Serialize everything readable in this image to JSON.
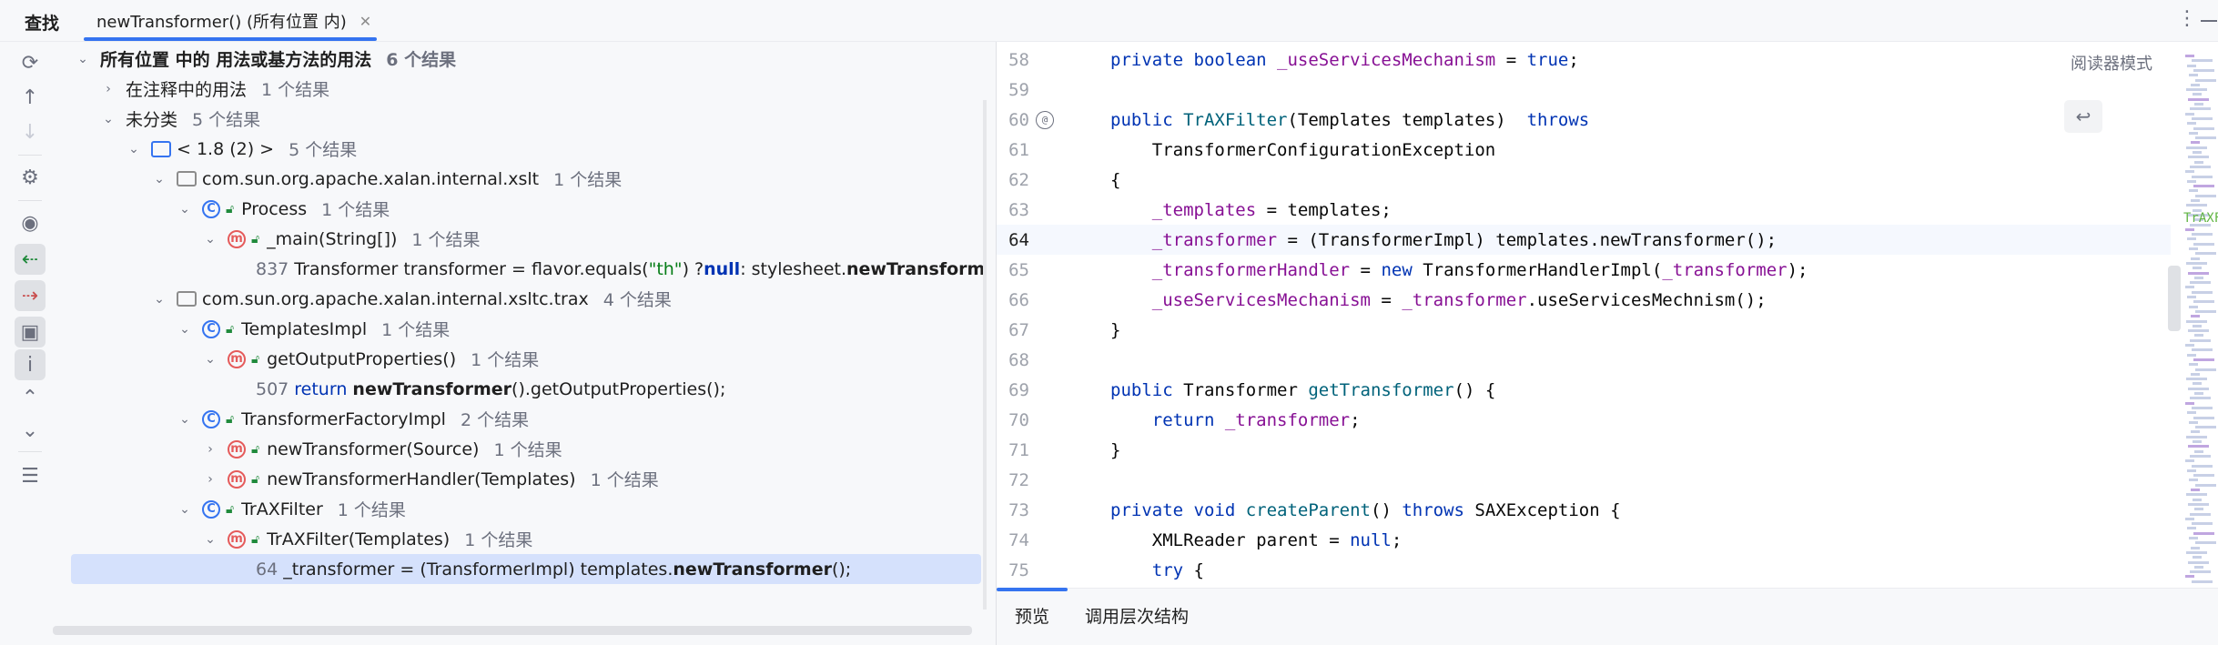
{
  "header": {
    "find_title": "查找",
    "tab_label": "newTransformer() (所有位置 内)",
    "close_glyph": "✕",
    "more_glyph": "⋮"
  },
  "tree": {
    "root": {
      "label": "所有位置 中的 用法或基方法的用法",
      "count": "6 个结果"
    },
    "comment_usage": {
      "label": "在注释中的用法",
      "count": "1 个结果"
    },
    "uncategorized": {
      "label": "未分类",
      "count": "5 个结果"
    },
    "jdk": {
      "label": "< 1.8 (2) >",
      "count": "5 个结果"
    },
    "pkg_xslt": {
      "label": "com.sun.org.apache.xalan.internal.xslt",
      "count": "1 个结果"
    },
    "process": {
      "label": "Process",
      "count": "1 个结果"
    },
    "main": {
      "label": "_main(String[])",
      "count": "1 个结果"
    },
    "line837": {
      "num": "837",
      "pre": "Transformer transformer = flavor.equals(",
      "str": "\"th\"",
      "mid": ") ? ",
      "kw": "null",
      "post": " : stylesheet.",
      "bold": "newTransformer",
      "end": "();"
    },
    "pkg_trax": {
      "label": "com.sun.org.apache.xalan.internal.xsltc.trax",
      "count": "4 个结果"
    },
    "templates_impl": {
      "label": "TemplatesImpl",
      "count": "1 个结果"
    },
    "get_output": {
      "label": "getOutputProperties()",
      "count": "1 个结果"
    },
    "line507": {
      "num": "507",
      "kw": "return",
      "bold": "newTransformer",
      "end": "().getOutputProperties();"
    },
    "factory_impl": {
      "label": "TransformerFactoryImpl",
      "count": "2 个结果"
    },
    "new_transformer_source": {
      "label": "newTransformer(Source)",
      "count": "1 个结果"
    },
    "new_transformer_handler": {
      "label": "newTransformerHandler(Templates)",
      "count": "1 个结果"
    },
    "trax_filter": {
      "label": "TrAXFilter",
      "count": "1 个结果"
    },
    "trax_filter_ctor": {
      "label": "TrAXFilter(Templates)",
      "count": "1 个结果"
    },
    "line64": {
      "num": "64",
      "pre": "_transformer = (TransformerImpl) templates.",
      "bold": "newTransformer",
      "end": "();"
    }
  },
  "editor": {
    "reader_mode": "阅读器模式",
    "minimap_label": "TrAXF",
    "lines": [
      {
        "n": "58",
        "parts": [
          [
            "k",
            "private "
          ],
          [
            "k",
            "boolean "
          ],
          [
            "f",
            "_useServicesMechanism"
          ],
          [
            "t",
            " = "
          ],
          [
            "k",
            "true"
          ],
          [
            "t",
            ";"
          ]
        ]
      },
      {
        "n": "59",
        "parts": []
      },
      {
        "n": "60",
        "parts": [
          [
            "k",
            "public "
          ],
          [
            "fn",
            "TrAXFilter"
          ],
          [
            "t",
            "(Templates templates)  "
          ],
          [
            "k",
            "throws"
          ]
        ]
      },
      {
        "n": "61",
        "parts": [
          [
            "t",
            "    TransformerConfigurationException"
          ]
        ]
      },
      {
        "n": "62",
        "parts": [
          [
            "t",
            "{"
          ]
        ]
      },
      {
        "n": "63",
        "parts": [
          [
            "t",
            "    "
          ],
          [
            "f",
            "_templates"
          ],
          [
            "t",
            " = templates;"
          ]
        ]
      },
      {
        "n": "64",
        "parts": [
          [
            "t",
            "    "
          ],
          [
            "f",
            "_transformer"
          ],
          [
            "t",
            " = (TransformerImpl) templates.newTransformer();"
          ]
        ]
      },
      {
        "n": "65",
        "parts": [
          [
            "t",
            "    "
          ],
          [
            "f",
            "_transformerHandler"
          ],
          [
            "t",
            " = "
          ],
          [
            "k",
            "new "
          ],
          [
            "t",
            "TransformerHandlerImpl("
          ],
          [
            "f",
            "_transformer"
          ],
          [
            "t",
            ");"
          ]
        ]
      },
      {
        "n": "66",
        "parts": [
          [
            "t",
            "    "
          ],
          [
            "f",
            "_useServicesMechanism"
          ],
          [
            "t",
            " = "
          ],
          [
            "f",
            "_transformer"
          ],
          [
            "t",
            ".useServicesMechnism();"
          ]
        ]
      },
      {
        "n": "67",
        "parts": [
          [
            "t",
            "}"
          ]
        ]
      },
      {
        "n": "68",
        "parts": []
      },
      {
        "n": "69",
        "parts": [
          [
            "k",
            "public "
          ],
          [
            "t",
            "Transformer "
          ],
          [
            "fn",
            "getTransformer"
          ],
          [
            "t",
            "() {"
          ]
        ]
      },
      {
        "n": "70",
        "parts": [
          [
            "t",
            "    "
          ],
          [
            "k",
            "return "
          ],
          [
            "f",
            "_transformer"
          ],
          [
            "t",
            ";"
          ]
        ]
      },
      {
        "n": "71",
        "parts": [
          [
            "t",
            "}"
          ]
        ]
      },
      {
        "n": "72",
        "parts": []
      },
      {
        "n": "73",
        "parts": [
          [
            "k",
            "private "
          ],
          [
            "k",
            "void "
          ],
          [
            "fn",
            "createParent"
          ],
          [
            "t",
            "() "
          ],
          [
            "k",
            "throws "
          ],
          [
            "t",
            "SAXException {"
          ]
        ]
      },
      {
        "n": "74",
        "parts": [
          [
            "t",
            "    XMLReader parent = "
          ],
          [
            "k",
            "null"
          ],
          [
            "t",
            ";"
          ]
        ]
      },
      {
        "n": "75",
        "parts": [
          [
            "t",
            "    "
          ],
          [
            "k",
            "try "
          ],
          [
            "t",
            "{"
          ]
        ]
      }
    ]
  },
  "bottom_tabs": {
    "preview": "预览",
    "call_hierarchy": "调用层次结构"
  },
  "colors": {
    "accent": "#3574f0",
    "selection": "#d5e1fc",
    "keyword": "#0033b3",
    "field": "#871094",
    "function": "#00627a"
  }
}
